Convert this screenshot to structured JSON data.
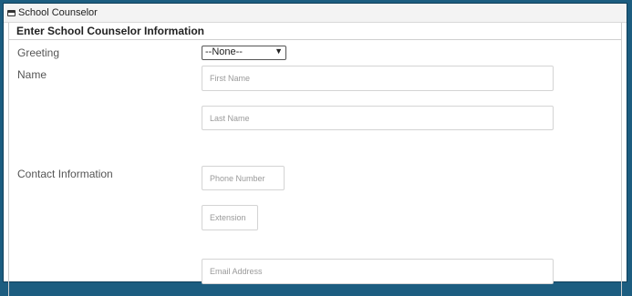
{
  "window": {
    "title": "School Counselor"
  },
  "panel": {
    "title": "Enter School Counselor Information"
  },
  "greeting": {
    "label": "Greeting",
    "selected": "--None--"
  },
  "name": {
    "label": "Name",
    "first_placeholder": "First Name",
    "last_placeholder": "Last Name"
  },
  "contact": {
    "label": "Contact Information",
    "phone_placeholder": "Phone Number",
    "extension_placeholder": "Extension",
    "email_placeholder": "Email Address"
  }
}
